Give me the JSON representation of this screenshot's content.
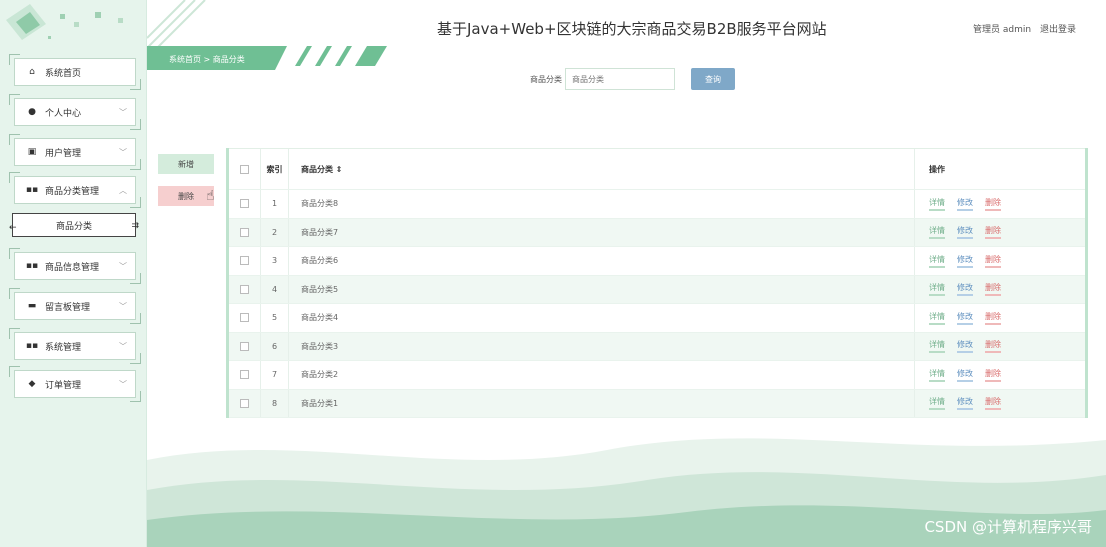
{
  "header": {
    "title": "基于Java+Web+区块链的大宗商品交易B2B服务平台网站",
    "user": "管理员 admin",
    "logout": "退出登录"
  },
  "breadcrumb": {
    "home": "系统首页",
    "separator": ">",
    "current": "商品分类"
  },
  "sidebar": {
    "items": [
      {
        "label": "系统首页",
        "icon": "home-icon"
      },
      {
        "label": "个人中心",
        "icon": "user-icon"
      },
      {
        "label": "用户管理",
        "icon": "clipboard-icon"
      },
      {
        "label": "商品分类管理",
        "icon": "grid-icon"
      },
      {
        "label": "商品分类",
        "icon": ""
      },
      {
        "label": "商品信息管理",
        "icon": "grid-icon"
      },
      {
        "label": "留言板管理",
        "icon": "chat-icon"
      },
      {
        "label": "系统管理",
        "icon": "grid-icon"
      },
      {
        "label": "订单管理",
        "icon": "thumb-icon"
      }
    ]
  },
  "search": {
    "label": "商品分类",
    "placeholder": "商品分类",
    "button": "查询"
  },
  "actions": {
    "add": "新增",
    "delete": "删除"
  },
  "table": {
    "columns": {
      "index": "索引",
      "name": "商品分类 ⇕",
      "ops": "操作"
    },
    "op_labels": {
      "detail": "详情",
      "edit": "修改",
      "remove": "删除"
    },
    "rows": [
      {
        "index": "1",
        "name": "商品分类8"
      },
      {
        "index": "2",
        "name": "商品分类7"
      },
      {
        "index": "3",
        "name": "商品分类6"
      },
      {
        "index": "4",
        "name": "商品分类5"
      },
      {
        "index": "5",
        "name": "商品分类4"
      },
      {
        "index": "6",
        "name": "商品分类3"
      },
      {
        "index": "7",
        "name": "商品分类2"
      },
      {
        "index": "8",
        "name": "商品分类1"
      }
    ]
  },
  "watermark": "CSDN @计算机程序兴哥",
  "colors": {
    "accent": "#6fbf94",
    "sidebar_bg": "#e6f4ec",
    "query_button": "#7fa8c8",
    "delete_red": "#d86a6a"
  }
}
